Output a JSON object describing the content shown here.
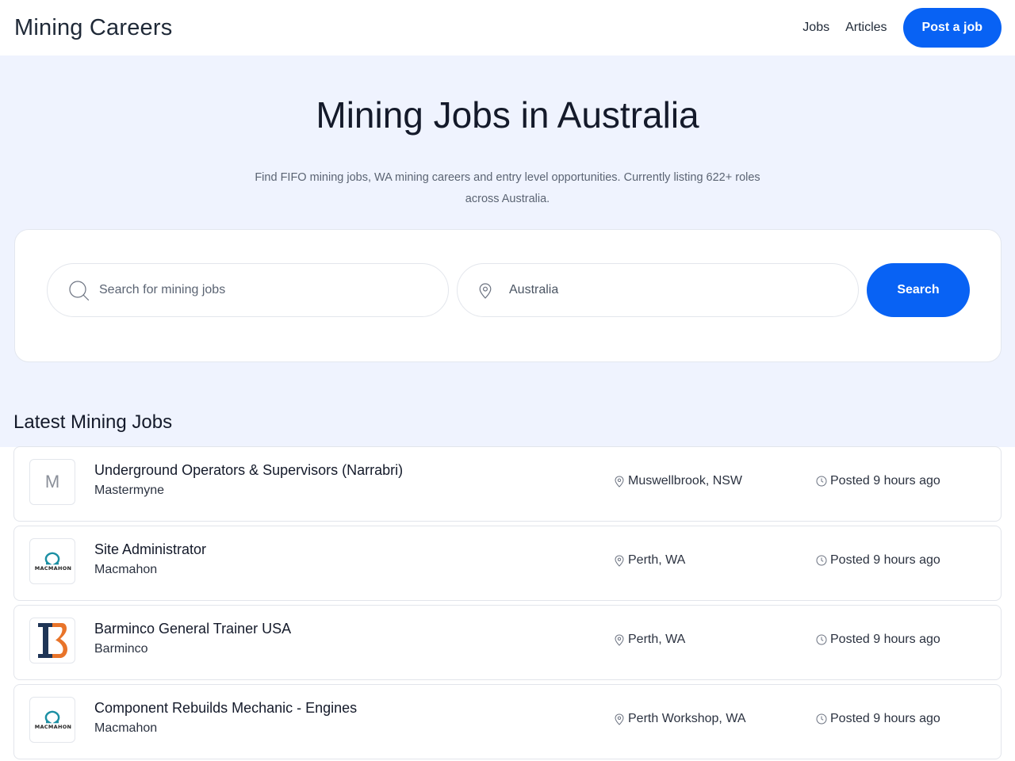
{
  "header": {
    "brand": "Mining Careers",
    "nav": [
      {
        "label": "Jobs"
      },
      {
        "label": "Articles"
      }
    ],
    "post_job_label": "Post a job"
  },
  "hero": {
    "title": "Mining Jobs in Australia",
    "subtitle": "Find FIFO mining jobs, WA mining careers and entry level opportunities. Currently listing 622+ roles across Australia.",
    "search": {
      "keyword_placeholder": "Search for mining jobs",
      "keyword_value": "",
      "location_value": "Australia",
      "location_placeholder": "Australia",
      "button_label": "Search"
    }
  },
  "latest": {
    "title": "Latest Mining Jobs",
    "jobs": [
      {
        "title": "Underground Operators & Supervisors (Narrabri)",
        "company": "Mastermyne",
        "location": "Muswellbrook, NSW",
        "posted": "Posted 9 hours ago",
        "logo": "letter-m",
        "logo_text": "M"
      },
      {
        "title": "Site Administrator",
        "company": "Macmahon",
        "location": "Perth, WA",
        "posted": "Posted 9 hours ago",
        "logo": "macmahon",
        "logo_text": "MACMAHON"
      },
      {
        "title": "Barminco General Trainer USA",
        "company": "Barminco",
        "location": "Perth, WA",
        "posted": "Posted 9 hours ago",
        "logo": "barminco",
        "logo_text": ""
      },
      {
        "title": "Component Rebuilds Mechanic - Engines",
        "company": "Macmahon",
        "location": "Perth Workshop, WA",
        "posted": "Posted 9 hours ago",
        "logo": "macmahon",
        "logo_text": "MACMAHON"
      }
    ]
  },
  "colors": {
    "accent": "#0862f4",
    "hero_bg": "#eff3fe",
    "macmahon_teal": "#1b8fa3",
    "barminco_navy": "#1f3556",
    "barminco_orange": "#e8742a"
  },
  "icons": {
    "search": "search-icon",
    "location": "map-pin-icon",
    "time": "clock-icon"
  }
}
